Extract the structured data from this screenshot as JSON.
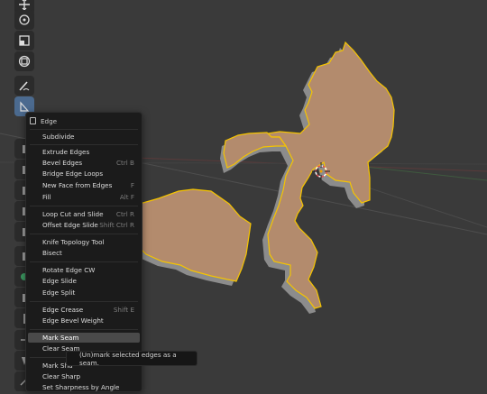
{
  "menu": {
    "title": "Edge",
    "items": [
      {
        "label": "Subdivide",
        "shortcut": ""
      },
      {
        "label": "Extrude Edges",
        "shortcut": ""
      },
      {
        "label": "Bevel Edges",
        "shortcut": "Ctrl B"
      },
      {
        "label": "Bridge Edge Loops",
        "shortcut": ""
      },
      {
        "label": "New Face from Edges",
        "shortcut": "F"
      },
      {
        "label": "Fill",
        "shortcut": "Alt F"
      },
      {
        "label": "Loop Cut and Slide",
        "shortcut": "Ctrl R"
      },
      {
        "label": "Offset Edge Slide",
        "shortcut": "Shift Ctrl R"
      },
      {
        "label": "Knife Topology Tool",
        "shortcut": ""
      },
      {
        "label": "Bisect",
        "shortcut": ""
      },
      {
        "label": "Rotate Edge CW",
        "shortcut": ""
      },
      {
        "label": "Edge Slide",
        "shortcut": ""
      },
      {
        "label": "Edge Split",
        "shortcut": ""
      },
      {
        "label": "Edge Crease",
        "shortcut": "Shift E"
      },
      {
        "label": "Edge Bevel Weight",
        "shortcut": ""
      },
      {
        "label": "Mark Seam",
        "shortcut": ""
      },
      {
        "label": "Clear Seam",
        "shortcut": ""
      },
      {
        "label": "Mark Sha",
        "shortcut": ""
      },
      {
        "label": "Clear Sharp",
        "shortcut": ""
      },
      {
        "label": "Set Sharpness by Angle",
        "shortcut": ""
      }
    ]
  },
  "tooltip": "(Un)mark selected edges as a seam.",
  "toolbar": {
    "icons": [
      "move-icon",
      "rotate-icon",
      "scale-icon",
      "transform-icon",
      "annotate-icon",
      "measure-icon",
      "extrude-icon",
      "inset-icon",
      "bevel-icon",
      "loop-cut-icon",
      "knife-icon",
      "poly-build-icon",
      "spin-icon",
      "smooth-icon",
      "edge-slide-icon",
      "shrink-fatten-icon",
      "shear-icon",
      "rip-icon"
    ]
  },
  "colors": {
    "viewport_bg": "#3a3a3a",
    "mesh_face": "#b38b6d",
    "mesh_side": "#8a8a8a",
    "selected_edge": "#f5c400",
    "menu_bg": "#1b1b1b",
    "highlight": "#4a4a4a"
  }
}
